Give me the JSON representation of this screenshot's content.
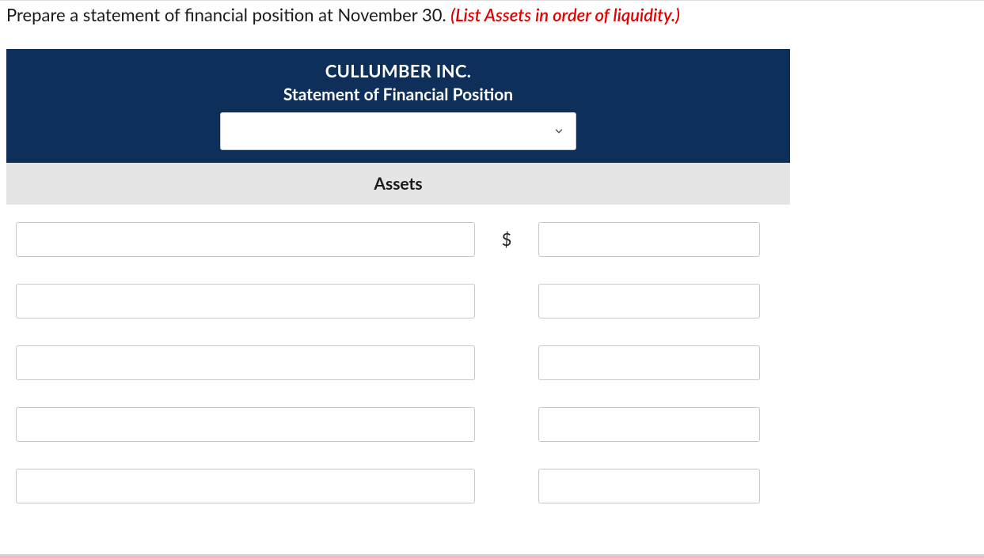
{
  "instruction": {
    "main": "Prepare a statement of financial position at November 30. ",
    "hint": "(List Assets in order of liquidity.)"
  },
  "header": {
    "company": "CULLUMBER INC.",
    "title": "Statement of Financial Position",
    "date_value": ""
  },
  "section": {
    "assets_label": "Assets"
  },
  "currency_symbol": "$",
  "rows": [
    {
      "label": "",
      "amount": "",
      "show_currency": true
    },
    {
      "label": "",
      "amount": "",
      "show_currency": false
    },
    {
      "label": "",
      "amount": "",
      "show_currency": false
    },
    {
      "label": "",
      "amount": "",
      "show_currency": false
    },
    {
      "label": "",
      "amount": "",
      "show_currency": false
    }
  ]
}
